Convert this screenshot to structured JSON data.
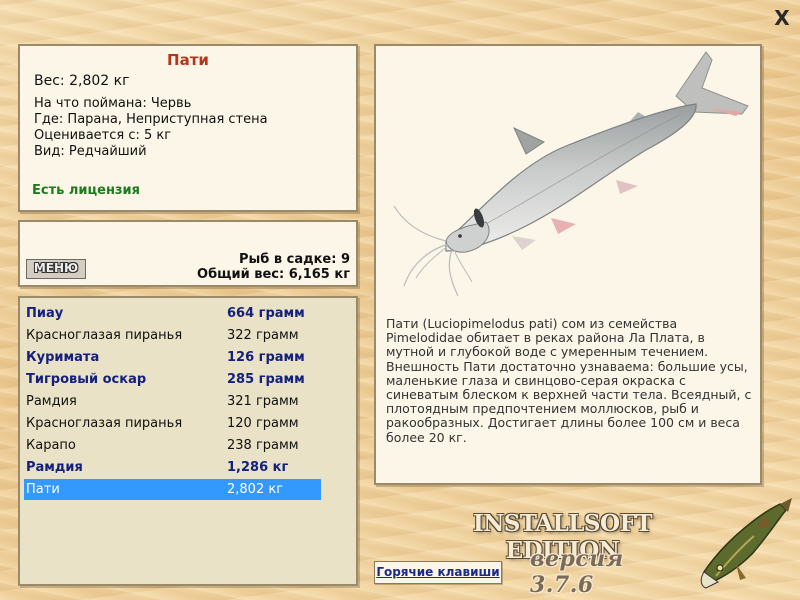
{
  "window": {
    "close_label": "X"
  },
  "info": {
    "title": "Пати",
    "weight": "Вес: 2,802 кг",
    "bait": "На что поймана: Червь",
    "location": "Где: Парана, Неприступная стена",
    "rated_from": "Оценивается с: 5 кг",
    "rarity": "Вид: Редчайший",
    "license": "Есть лицензия"
  },
  "cage": {
    "menu_label": "МЕНЮ",
    "fish_count": "Рыб в садке: 9",
    "total_weight": "Общий вес: 6,165 кг"
  },
  "catch_list": [
    {
      "name": "Пиау",
      "weight": "664 грамм",
      "big": true
    },
    {
      "name": "Красноглазая пиранья",
      "weight": "322 грамм",
      "big": false
    },
    {
      "name": "Куримата",
      "weight": "126 грамм",
      "big": true
    },
    {
      "name": "Тигровый оскар",
      "weight": "285 грамм",
      "big": true
    },
    {
      "name": "Рамдия",
      "weight": "321 грамм",
      "big": false
    },
    {
      "name": "Красноглазая пиранья",
      "weight": "120 грамм",
      "big": false
    },
    {
      "name": "Карапо",
      "weight": "238 грамм",
      "big": false
    },
    {
      "name": "Рамдия",
      "weight": "1,286 кг",
      "big": true
    },
    {
      "name": "Пати",
      "weight": "2,802 кг",
      "big": false,
      "selected": true
    }
  ],
  "description": "Пати (Luciopimelodus pati) сом из семейства Pimelodidae обитает в реках района Ла Плата, в мутной и глубокой воде с умеренным течением. Внешность Пати достаточно узнаваема: большие усы, маленькие глаза и свинцово-серая окраска с синеватым блеском к верхней части тела. Всеядный, с плотоядным предпочтением моллюсков, рыб и ракообразных. Достигает длины более 100 см и веса более 20 кг.",
  "hotkeys_label": "Горячие клавиши",
  "brand": {
    "edition": "INSTALLSOFT EDITION",
    "version": "версия 3.7.6"
  },
  "colors": {
    "title_red": "#b3361a",
    "license_green": "#1d7a1d",
    "big_fish_blue": "#13207c",
    "selection_blue": "#3399ff"
  }
}
